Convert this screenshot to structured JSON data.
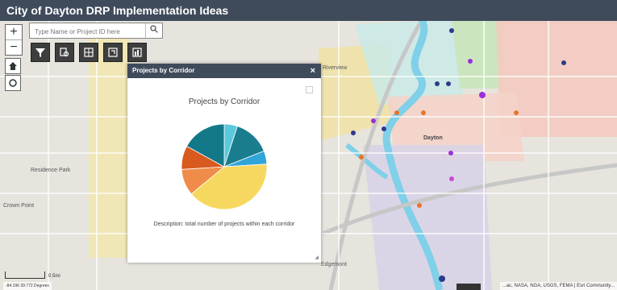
{
  "app": {
    "title": "City of Dayton DRP Implementation Ideas"
  },
  "controls": {
    "zoom_in": "+",
    "zoom_out": "−",
    "search_placeholder": "Type Name or Project ID here"
  },
  "tools": [
    {
      "name": "filter-tool",
      "icon": "filter-icon"
    },
    {
      "name": "query-tool",
      "icon": "query-icon"
    },
    {
      "name": "grid-tool",
      "icon": "grid-icon"
    },
    {
      "name": "layer-tool",
      "icon": "layer-icon"
    },
    {
      "name": "chart-tool",
      "icon": "chart-icon"
    }
  ],
  "map": {
    "labels": [
      "Riverview",
      "Dayton",
      "Residence Park",
      "Edgemont",
      "Crown Point"
    ],
    "scale": "0.5mi",
    "coords": "-84.196 39.772 Degrees",
    "attribution": "...ac, NASA, NGA, USGS, FEMA | Esri Community..."
  },
  "panel": {
    "header": "Projects by Corridor",
    "close": "×",
    "chart_title": "Projects by Corridor",
    "description": "Description: total number of projects within each corridor"
  },
  "chart_data": {
    "type": "pie",
    "title": "Projects by Corridor",
    "slices": [
      {
        "value": 5,
        "color": "#5bc9dc"
      },
      {
        "value": 14,
        "color": "#1a7d8e"
      },
      {
        "value": 5,
        "color": "#2fa5d8"
      },
      {
        "value": 40,
        "color": "#f6d860"
      },
      {
        "value": 10,
        "color": "#f08c4a"
      },
      {
        "value": 9,
        "color": "#d95a1f"
      },
      {
        "value": 17,
        "color": "#137888"
      }
    ]
  },
  "colors": {
    "header_bg": "#3f4b5b",
    "tool_bg": "#3e3e3e"
  }
}
